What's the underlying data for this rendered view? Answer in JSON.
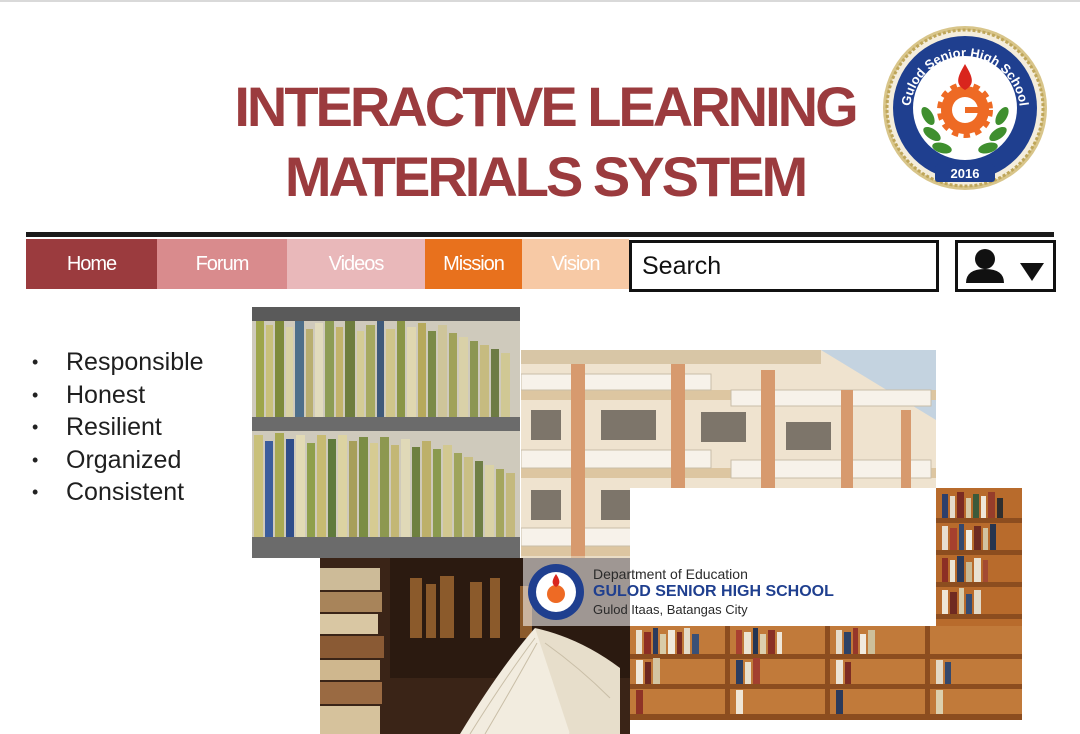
{
  "header": {
    "title_line1": "INTERACTIVE LEARNING",
    "title_line2": "MATERIALS SYSTEM"
  },
  "seal": {
    "text": "Gulod Senior High School",
    "year": "2016"
  },
  "nav": {
    "items": [
      {
        "label": "Home",
        "color": "#9b3b3e"
      },
      {
        "label": "Forum",
        "color": "#d98b8d"
      },
      {
        "label": "Videos",
        "color": "#e9b8ba"
      },
      {
        "label": "Mission",
        "color": "#e8711d"
      },
      {
        "label": "Vision",
        "color": "#f7c9a5"
      }
    ],
    "search_placeholder": "Search",
    "user_icon": "user-icon",
    "dropdown_icon": "caret-down-icon"
  },
  "values": [
    "Responsible",
    "Honest",
    "Resilient",
    "Organized",
    "Consistent"
  ],
  "banner": {
    "line1": "Department of Education",
    "line2": "GULOD SENIOR HIGH SCHOOL",
    "line3": "Gulod Itaas, Batangas City"
  },
  "colors": {
    "title": "#9b3b3e",
    "accent": "#e8711d"
  }
}
